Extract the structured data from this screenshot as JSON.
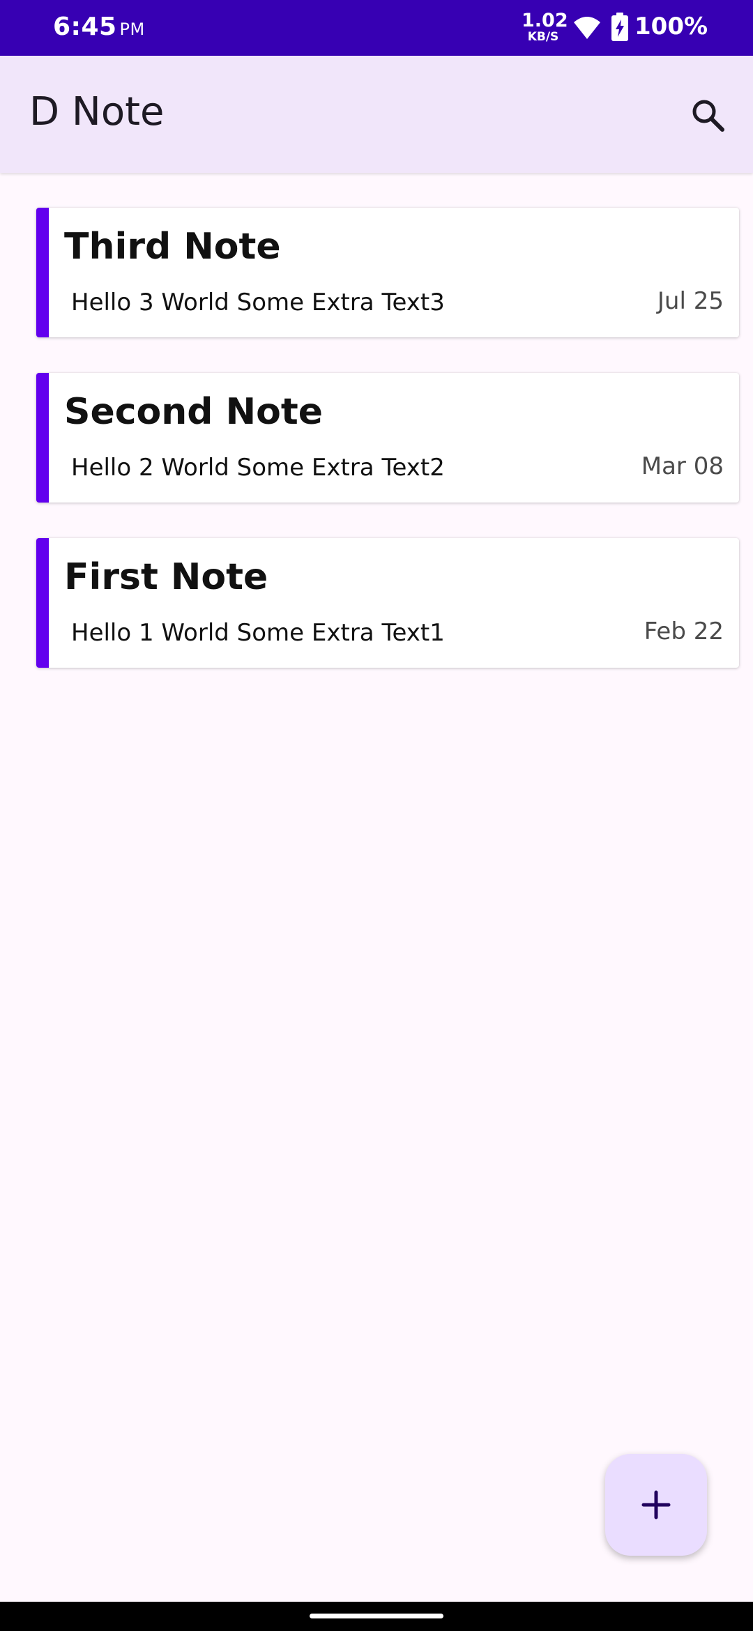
{
  "status_bar": {
    "time": "6:45",
    "time_suffix": "PM",
    "net_speed_value": "1.02",
    "net_speed_unit": "KB/S",
    "battery_percent": "100%",
    "background_color": "#3700B3"
  },
  "app_bar": {
    "title": "D Note",
    "search_icon": "search-icon",
    "background_color": "#F1E6FA"
  },
  "notes": [
    {
      "title": "Third Note",
      "body": "Hello 3 World Some Extra Text3",
      "date": "Jul 25"
    },
    {
      "title": "Second Note",
      "body": "Hello 2 World Some Extra Text2",
      "date": "Mar 08"
    },
    {
      "title": "First Note",
      "body": "Hello 1 World Some Extra Text1",
      "date": "Feb 22"
    }
  ],
  "fab": {
    "icon": "plus-icon",
    "background_color": "#EADDFF"
  },
  "colors": {
    "accent": "#6200EE",
    "page_background": "#FFF8FE"
  }
}
